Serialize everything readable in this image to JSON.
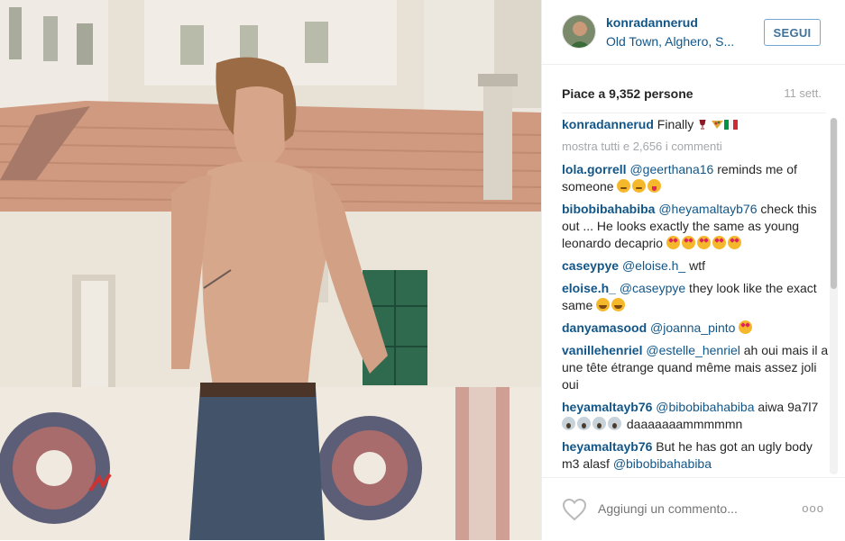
{
  "post": {
    "username": "konradannerud",
    "location": "Old Town, Alghero, S...",
    "follow_label": "SEGUI",
    "likes_text": "Piace a 9,352 persone",
    "time_ago": "11 sett.",
    "caption_text": "Finally",
    "show_all_comments": "mostra tutti e 2,656 i commenti"
  },
  "comments": [
    {
      "user": "lola.gorrell",
      "mention": "@geerthana16",
      "text": " reminds me of someone",
      "emoji": [
        "smirk",
        "smirk",
        "tongue"
      ]
    },
    {
      "user": "bibobibahabiba",
      "mention": "@heyamaltayb76",
      "text": " check this out ... He looks exactly the same as young leonardo decaprio",
      "emoji": [
        "hearteyes",
        "hearteyes",
        "hearteyes",
        "hearteyes",
        "hearteyes"
      ]
    },
    {
      "user": "caseypye",
      "mention": "@eloise.h_",
      "text": " wtf",
      "emoji": []
    },
    {
      "user": "eloise.h_",
      "mention": "@caseypye",
      "text": " they look like the exact same",
      "emoji": [
        "joy",
        "joy"
      ]
    },
    {
      "user": "danyamasood",
      "mention": "@joanna_pinto",
      "text": "",
      "emoji": [
        "hearteyes"
      ]
    },
    {
      "user": "vanillehenriel",
      "mention": "@estelle_henriel",
      "text": " ah oui mais il a une tête étrange quand même mais assez joli oui",
      "emoji": []
    },
    {
      "user": "heyamaltayb76",
      "mention": "@bibobibahabiba",
      "text": " aiwa 9a7l7",
      "emoji": [
        "scream",
        "scream",
        "scream",
        "scream"
      ],
      "after": " daaaaaaammmmmn"
    },
    {
      "user": "heyamaltayb76",
      "mention": "",
      "text": " But he has got an ugly body m3 alasf ",
      "emoji": [],
      "after_mention": "@bibobibahabiba"
    }
  ],
  "footer": {
    "comment_placeholder": "Aggiungi un commento...",
    "more_label": "ooo"
  },
  "icons": {
    "like": "heart-icon",
    "options": "more-options-icon"
  }
}
